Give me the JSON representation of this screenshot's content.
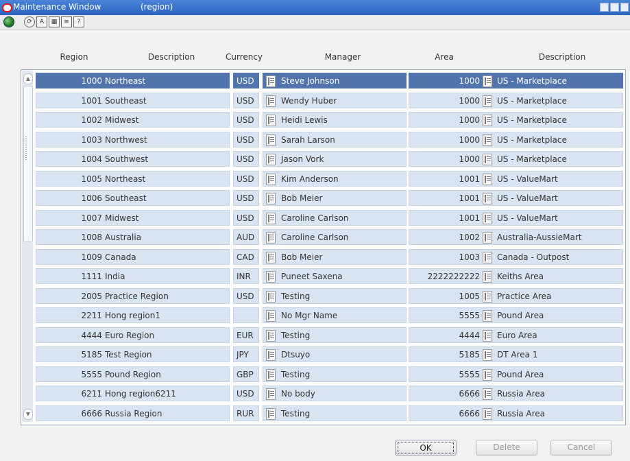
{
  "window": {
    "title": "Maintenance Window",
    "subtitle": "(region)",
    "controls": [
      "minimize-icon",
      "maximize-icon",
      "close-icon"
    ]
  },
  "toolbar": {
    "icons": [
      "globe-icon",
      "refresh-icon",
      "font-icon",
      "calendar-icon",
      "note-icon",
      "help-icon"
    ],
    "font_glyph": "A",
    "help_glyph": "?"
  },
  "table": {
    "columns": {
      "region": "Region",
      "region_description": "Description",
      "currency": "Currency",
      "manager": "Manager",
      "area": "Area",
      "area_description": "Description"
    },
    "rows": [
      {
        "region": "1000",
        "desc": "Northeast",
        "currency": "USD",
        "manager": "Steve Johnson",
        "area": "1000",
        "area_desc": "US - Marketplace"
      },
      {
        "region": "1001",
        "desc": "Southeast",
        "currency": "USD",
        "manager": "Wendy Huber",
        "area": "1000",
        "area_desc": "US - Marketplace"
      },
      {
        "region": "1002",
        "desc": "Midwest",
        "currency": "USD",
        "manager": "Heidi Lewis",
        "area": "1000",
        "area_desc": "US - Marketplace"
      },
      {
        "region": "1003",
        "desc": "Northwest",
        "currency": "USD",
        "manager": "Sarah Larson",
        "area": "1000",
        "area_desc": "US - Marketplace"
      },
      {
        "region": "1004",
        "desc": "Southwest",
        "currency": "USD",
        "manager": "Jason Vork",
        "area": "1000",
        "area_desc": "US - Marketplace"
      },
      {
        "region": "1005",
        "desc": "Northeast",
        "currency": "USD",
        "manager": "Kim Anderson",
        "area": "1001",
        "area_desc": "US - ValueMart"
      },
      {
        "region": "1006",
        "desc": "Southeast",
        "currency": "USD",
        "manager": "Bob Meier",
        "area": "1001",
        "area_desc": "US - ValueMart"
      },
      {
        "region": "1007",
        "desc": "Midwest",
        "currency": "USD",
        "manager": "Caroline Carlson",
        "area": "1001",
        "area_desc": "US - ValueMart"
      },
      {
        "region": "1008",
        "desc": "Australia",
        "currency": "AUD",
        "manager": "Caroline Carlson",
        "area": "1002",
        "area_desc": "Australia-AussieMart"
      },
      {
        "region": "1009",
        "desc": "Canada",
        "currency": "CAD",
        "manager": "Bob Meier",
        "area": "1003",
        "area_desc": "Canada - Outpost"
      },
      {
        "region": "1111",
        "desc": "India",
        "currency": "INR",
        "manager": "Puneet Saxena",
        "area": "2222222222",
        "area_desc": "Keiths Area"
      },
      {
        "region": "2005",
        "desc": "Practice Region",
        "currency": "USD",
        "manager": "Testing",
        "area": "1005",
        "area_desc": "Practice Area"
      },
      {
        "region": "2211",
        "desc": "Hong region1",
        "currency": "",
        "manager": "No Mgr Name",
        "area": "5555",
        "area_desc": "Pound Area"
      },
      {
        "region": "4444",
        "desc": "Euro Region",
        "currency": "EUR",
        "manager": "Testing",
        "area": "4444",
        "area_desc": "Euro Area"
      },
      {
        "region": "5185",
        "desc": "Test Region",
        "currency": "JPY",
        "manager": "Dtsuyo",
        "area": "5185",
        "area_desc": "DT Area 1"
      },
      {
        "region": "5555",
        "desc": "Pound Region",
        "currency": "GBP",
        "manager": "Testing",
        "area": "5555",
        "area_desc": "Pound Area"
      },
      {
        "region": "6211",
        "desc": "Hong region6211",
        "currency": "USD",
        "manager": "No body",
        "area": "6666",
        "area_desc": "Russia Area"
      },
      {
        "region": "6666",
        "desc": "Russia Region",
        "currency": "RUR",
        "manager": "Testing",
        "area": "6666",
        "area_desc": "Russia Area"
      }
    ],
    "selected_index": 0,
    "lov_icon": "list-of-values-icon"
  },
  "scrollbar": {
    "up_glyph": "▲",
    "down_glyph": "▼"
  },
  "buttons": {
    "ok": {
      "label": "OK",
      "enabled": true
    },
    "delete": {
      "label": "Delete",
      "enabled": false
    },
    "cancel": {
      "label": "Cancel",
      "enabled": false
    }
  },
  "colors": {
    "selected_row": "#5274ad",
    "cell_bg": "#d9e4f3",
    "titlebar": "#2d63c0"
  }
}
